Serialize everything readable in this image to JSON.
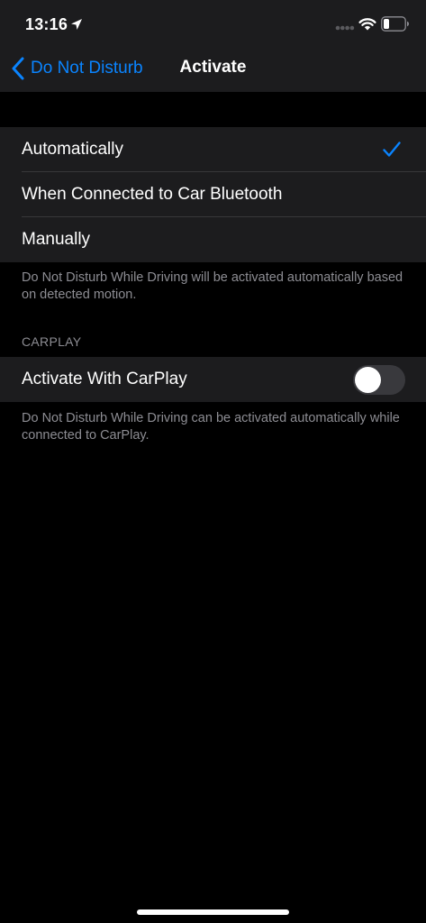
{
  "status_bar": {
    "time": "13:16",
    "icons": [
      "location-arrow-icon",
      "cellular-signal-icon",
      "wifi-icon",
      "battery-icon"
    ]
  },
  "nav": {
    "back_label": "Do Not Disturb",
    "title": "Activate"
  },
  "activate_group": {
    "options": [
      {
        "label": "Automatically",
        "selected": true
      },
      {
        "label": "When Connected to Car Bluetooth",
        "selected": false
      },
      {
        "label": "Manually",
        "selected": false
      }
    ],
    "footer": "Do Not Disturb While Driving will be activated automatically based on detected motion."
  },
  "carplay_group": {
    "header": "CARPLAY",
    "toggle_label": "Activate With CarPlay",
    "toggle_on": false,
    "footer": "Do Not Disturb While Driving can be activated automatically while connected to CarPlay."
  },
  "colors": {
    "accent": "#0a84ff",
    "background": "#000000",
    "cell": "#1c1c1e",
    "secondary_text": "#8d8d93",
    "toggle_off": "#39393d"
  }
}
